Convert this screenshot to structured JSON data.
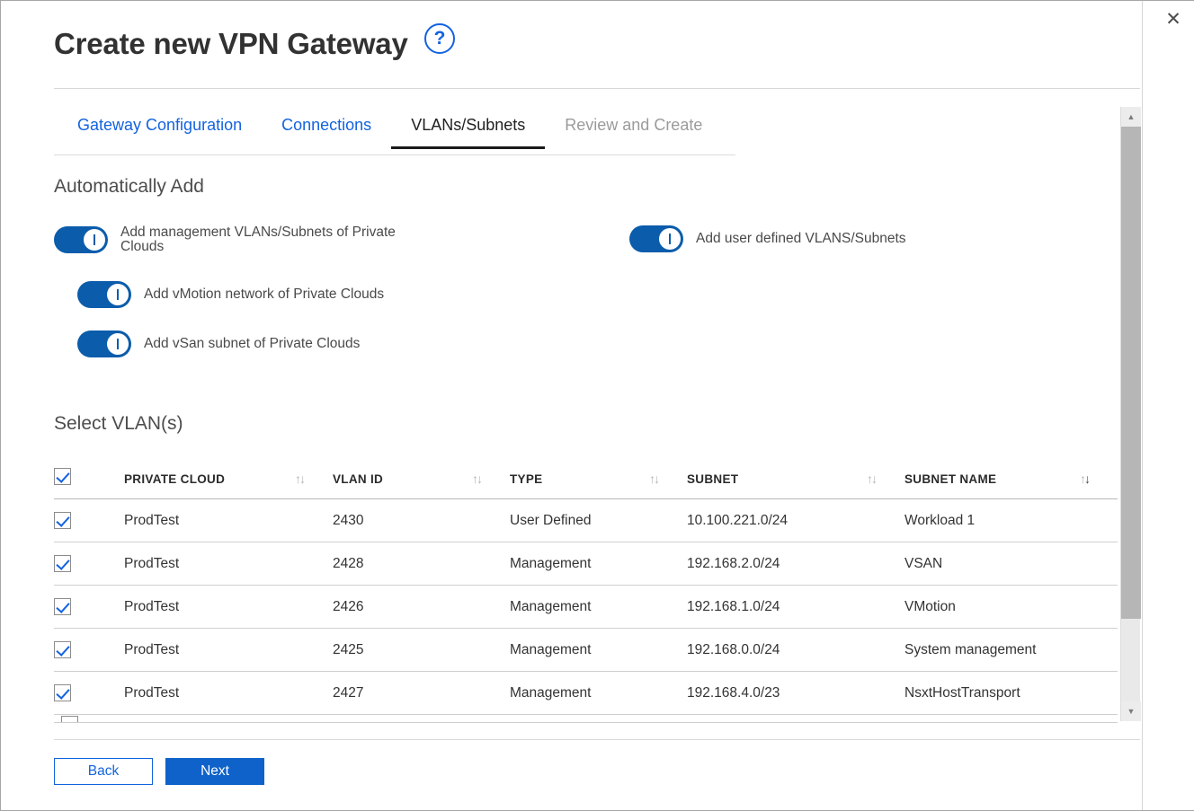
{
  "window": {
    "close_label": "✕"
  },
  "header": {
    "title": "Create new VPN Gateway",
    "help_label": "?",
    "help_icon": "question-circle-icon"
  },
  "tabs": [
    {
      "label": "Gateway Configuration",
      "state": "link"
    },
    {
      "label": "Connections",
      "state": "link"
    },
    {
      "label": "VLANs/Subnets",
      "state": "active"
    },
    {
      "label": "Review and Create",
      "state": "disabled"
    }
  ],
  "sections": {
    "auto_add_heading": "Automatically Add",
    "select_vlans_heading": "Select VLAN(s)"
  },
  "toggles": [
    {
      "label": "Add management VLANs/Subnets of Private Clouds",
      "on": true
    },
    {
      "label": "Add user defined VLANS/Subnets",
      "on": true
    },
    {
      "label": "Add vMotion network of Private Clouds",
      "on": true
    },
    {
      "label": "Add vSan subnet of Private Clouds",
      "on": true
    }
  ],
  "table": {
    "select_all_checked": true,
    "columns": [
      "PRIVATE CLOUD",
      "VLAN ID",
      "TYPE",
      "SUBNET",
      "SUBNET NAME"
    ],
    "sort_icon_up": "↑",
    "sort_icon_down": "↓",
    "active_sort_column": "SUBNET NAME",
    "active_sort_direction": "desc",
    "rows": [
      {
        "checked": true,
        "private_cloud": "ProdTest",
        "vlan_id": "2430",
        "type": "User Defined",
        "subnet": "10.100.221.0/24",
        "subnet_name": "Workload 1"
      },
      {
        "checked": true,
        "private_cloud": "ProdTest",
        "vlan_id": "2428",
        "type": "Management",
        "subnet": "192.168.2.0/24",
        "subnet_name": "VSAN"
      },
      {
        "checked": true,
        "private_cloud": "ProdTest",
        "vlan_id": "2426",
        "type": "Management",
        "subnet": "192.168.1.0/24",
        "subnet_name": "VMotion"
      },
      {
        "checked": true,
        "private_cloud": "ProdTest",
        "vlan_id": "2425",
        "type": "Management",
        "subnet": "192.168.0.0/24",
        "subnet_name": "System management"
      },
      {
        "checked": true,
        "private_cloud": "ProdTest",
        "vlan_id": "2427",
        "type": "Management",
        "subnet": "192.168.4.0/23",
        "subnet_name": "NsxtHostTransport"
      }
    ]
  },
  "scrollbar": {
    "up_arrow": "▲",
    "down_arrow": "▼"
  },
  "footer": {
    "back_label": "Back",
    "next_label": "Next"
  },
  "colors": {
    "accent_blue": "#1363DF",
    "primary_button": "#0F62C9",
    "toggle_on": "#0B5CAB",
    "active_tab_underline": "#1a1a1a",
    "text": "#333333",
    "muted_text": "#9b9b9b"
  }
}
